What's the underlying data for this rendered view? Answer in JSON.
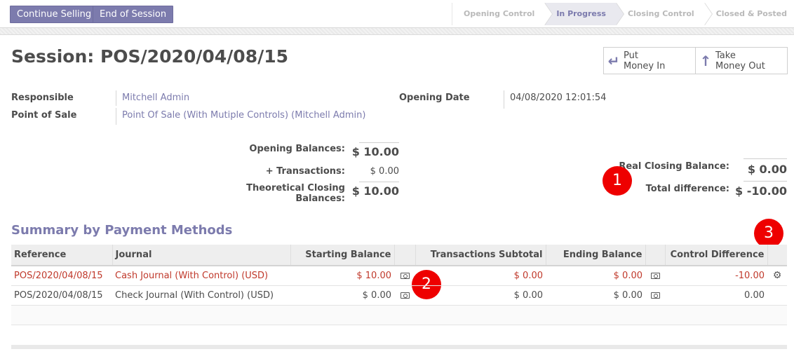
{
  "toolbar": {
    "continue_label": "Continue Selling",
    "end_label": "End of Session"
  },
  "stages": [
    {
      "label": "Opening Control",
      "active": false
    },
    {
      "label": "In Progress",
      "active": true
    },
    {
      "label": "Closing Control",
      "active": false
    },
    {
      "label": "Closed & Posted",
      "active": false
    }
  ],
  "session": {
    "title": "Session: POS/2020/04/08/15",
    "responsible_label": "Responsible",
    "responsible": "Mitchell Admin",
    "pos_label": "Point of Sale",
    "pos": "Point Of Sale (With Mutiple Controls) (Mitchell Admin)",
    "opening_date_label": "Opening Date",
    "opening_date": "04/08/2020 12:01:54"
  },
  "actions": {
    "put_in": [
      "Put",
      "Money In"
    ],
    "take_out": [
      "Take",
      "Money Out"
    ]
  },
  "balances": {
    "opening_label": "Opening Balances:",
    "opening": "$ 10.00",
    "transactions_label": "+ Transactions:",
    "transactions": "$ 0.00",
    "theoretical_label": "Theoretical Closing Balances:",
    "theoretical": "$ 10.00",
    "real_closing_label": "Real Closing Balance:",
    "real_closing": "$ 0.00",
    "difference_label": "Total difference:",
    "difference": "$ -10.00"
  },
  "markers": [
    "1",
    "2",
    "3"
  ],
  "summary": {
    "title": "Summary by Payment Methods",
    "headers": [
      "Reference",
      "Journal",
      "Starting Balance",
      "Transactions Subtotal",
      "Ending Balance",
      "Control Difference"
    ],
    "rows": [
      {
        "reference": "POS/2020/04/08/15",
        "journal": "Cash Journal (With Control) (USD)",
        "starting": "$ 10.00",
        "transactions": "$ 0.00",
        "ending": "$ 0.00",
        "difference": "-10.00"
      },
      {
        "reference": "POS/2020/04/08/15",
        "journal": "Check Journal (With Control) (USD)",
        "starting": "$ 0.00",
        "transactions": "$ 0.00",
        "ending": "$ 0.00",
        "difference": "0.00"
      }
    ]
  },
  "colors": {
    "accent": "#7c7bad",
    "marker": "#ee0000",
    "negative_row": "#c0392b"
  }
}
